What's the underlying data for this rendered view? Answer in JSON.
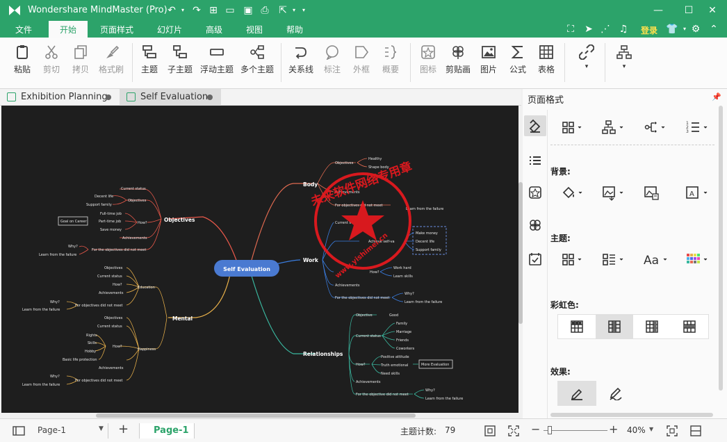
{
  "app": {
    "title": "Wondershare MindMaster (Pro)",
    "login_label": "登录"
  },
  "menu": {
    "items": [
      "文件",
      "开始",
      "页面样式",
      "幻灯片",
      "高级",
      "视图",
      "帮助"
    ],
    "active": "开始"
  },
  "ribbon": {
    "paste": "粘贴",
    "cut": "剪切",
    "copy": "拷贝",
    "format_painter": "格式刷",
    "topic": "主题",
    "subtopic": "子主题",
    "floating_topic": "浮动主题",
    "multiple_topics": "多个主题",
    "relationship": "关系线",
    "callout": "标注",
    "boundary": "外框",
    "summary": "概要",
    "icon": "图标",
    "clipart": "剪贴画",
    "picture": "图片",
    "formula": "公式",
    "table": "表格"
  },
  "tabs": [
    {
      "label": "Exhibition Planning",
      "active": false
    },
    {
      "label": "Self Evaluation",
      "active": true
    }
  ],
  "right_panel": {
    "title": "页面格式",
    "background_label": "背景:",
    "theme_label": "主题:",
    "rainbow_label": "彩虹色:",
    "effect_label": "效果:"
  },
  "status": {
    "page_select": "Page-1",
    "page_tab": "Page-1",
    "topic_count_label": "主题计数:",
    "topic_count": "79",
    "zoom": "40%"
  },
  "mindmap": {
    "central": "Self Evaluation",
    "objectives": {
      "label": "Objectives",
      "current_status": "Current status",
      "sub_objectives": "Objectives",
      "decent_life": "Decent life",
      "support_family": "Support family",
      "how": "How?",
      "full_time_job": "Full-time job",
      "part_time_job": "Part-time job",
      "save_money": "Save money",
      "goal_on_career": "Goal on Career",
      "achievements": "Achievements",
      "not_meet": "For the objectives did not meet",
      "why": "Why?",
      "learn_failure": "Learn from the failure"
    },
    "mental": {
      "label": "Mental",
      "education": "Education",
      "edu_objectives": "Objectives",
      "edu_current_status": "Current status",
      "edu_how": "How?",
      "edu_achievements": "Achievements",
      "edu_not_meet": "For objectives did not meet",
      "edu_why": "Why?",
      "edu_learn": "Learn from the failure",
      "happiness": "Happiness",
      "hap_objectives": "Objectives",
      "hap_current_status": "Current status",
      "hap_how": "How?",
      "rights": "Rights",
      "skills": "Skills",
      "hobby": "Hobby",
      "basic_life": "Basic life protection",
      "hap_achievements": "Achievements",
      "hap_not_meet": "For objectives did not meet",
      "hap_why": "Why?",
      "hap_learn": "Learn from the failure"
    },
    "body": {
      "label": "Body",
      "objectives": "Objectives",
      "healthy": "Healthy",
      "shape_body": "Shape body",
      "achievements": "Achievements",
      "not_meet": "For objectives did not meet",
      "learn": "Learn from the failure"
    },
    "work": {
      "label": "Work",
      "current": "Current s",
      "achieve_self": "Achieve self-va",
      "make_money": "Make money",
      "decent_life": "Decent life",
      "support_family": "Support family",
      "how": "How?",
      "work_hard": "Work hard",
      "learn_skills": "Learn skills",
      "achievements": "Achievements",
      "not_meet": "For the objectives did not meet",
      "why": "Why?",
      "learn": "Learn from the failure"
    },
    "relationships": {
      "label": "Relationships",
      "objective": "Objective",
      "good": "Good",
      "current_status": "Current status",
      "family": "Family",
      "marriage": "Marriage",
      "friends": "Friends",
      "coworkers": "Coworkers",
      "how": "How?",
      "positive": "Positive attitude",
      "truth": "Truth emotional",
      "need_skills": "Need skills",
      "more_eval": "More Evaluation",
      "achievements": "Achievements",
      "not_meet": "For the objective did not meet",
      "why": "Why?",
      "learn": "Learn from the failure"
    },
    "watermark_text": "未来软件网络专用章",
    "watermark_url": "www.yishimei.cn"
  },
  "colors": {
    "brand": "#2ca36a",
    "canvas_bg": "#1e1e1e",
    "central_node": "#4a7ad1",
    "branch_objectives": "#e8584a",
    "branch_mental": "#e8b04a",
    "branch_body": "#e06a50",
    "branch_work": "#3a7de0",
    "branch_relationships": "#3ab8a0",
    "stamp": "#e8191e"
  }
}
